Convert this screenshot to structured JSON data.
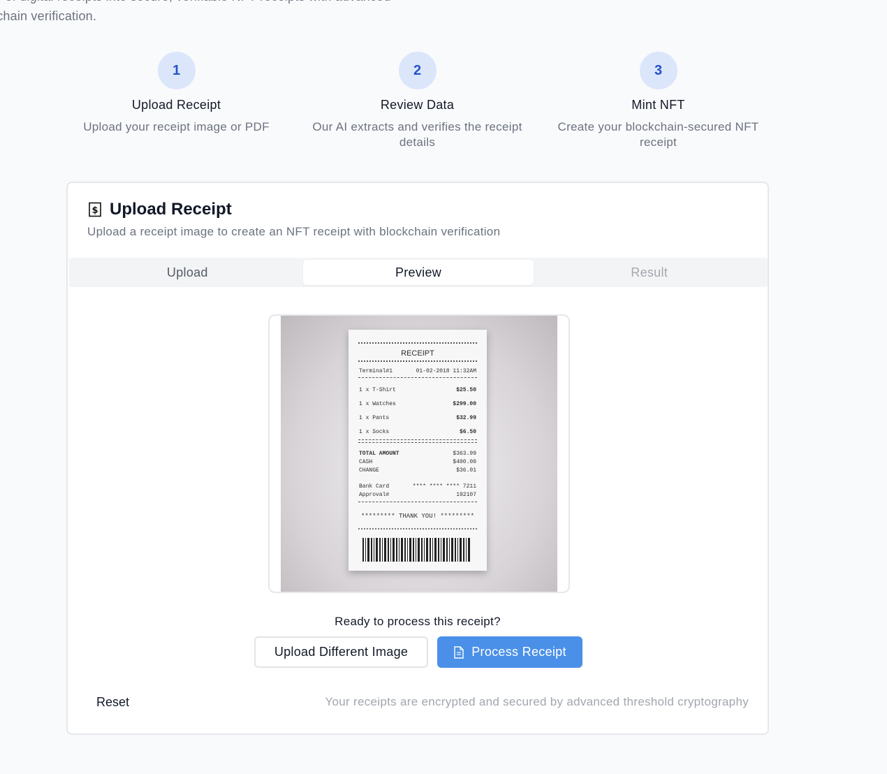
{
  "intro": {
    "line1": "er of digital receipts into secure, verifiable NFT receipts with advanced",
    "line2": "kchain verification."
  },
  "steps": [
    {
      "number": "1",
      "title": "Upload Receipt",
      "description": "Upload your receipt image or PDF"
    },
    {
      "number": "2",
      "title": "Review Data",
      "description": "Our AI extracts and verifies the receipt details"
    },
    {
      "number": "3",
      "title": "Mint NFT",
      "description": "Create your blockchain-secured NFT receipt"
    }
  ],
  "card": {
    "icon": "receipt-icon",
    "title": "Upload Receipt",
    "subtitle": "Upload a receipt image to create an NFT receipt with blockchain verification"
  },
  "tabs": [
    {
      "label": "Upload",
      "state": "default"
    },
    {
      "label": "Preview",
      "state": "active"
    },
    {
      "label": "Result",
      "state": "disabled"
    }
  ],
  "receipt_image": {
    "title": "RECEIPT",
    "terminal": "Terminal#1",
    "datetime": "01-02-2018   11:32AM",
    "items": [
      {
        "name": "1 x T-Shirt",
        "price": "$25.50"
      },
      {
        "name": "1 x Watches",
        "price": "$299.00"
      },
      {
        "name": "1 x Pants",
        "price": "$32.99"
      },
      {
        "name": "1 x Socks",
        "price": "$6.50"
      }
    ],
    "total_label": "TOTAL AMOUNT",
    "total": "$363.99",
    "cash_label": "CASH",
    "cash": "$400.00",
    "change_label": "CHANGE",
    "change": "$36.01",
    "card_label": "Bank Card",
    "card": "**** **** **** 7211",
    "approval_label": "Approval#",
    "approval": "192107",
    "thanks": "********* THANK YOU! *********"
  },
  "prompt": "Ready to process this receipt?",
  "buttons": {
    "upload_different": "Upload Different Image",
    "process": "Process Receipt",
    "process_icon": "document-icon",
    "reset": "Reset"
  },
  "footnote": "Your receipts are encrypted and secured by advanced threshold cryptography",
  "colors": {
    "accent": "#4a90e8",
    "step_circle_bg": "#dbe6fb",
    "step_number": "#2653c9"
  }
}
